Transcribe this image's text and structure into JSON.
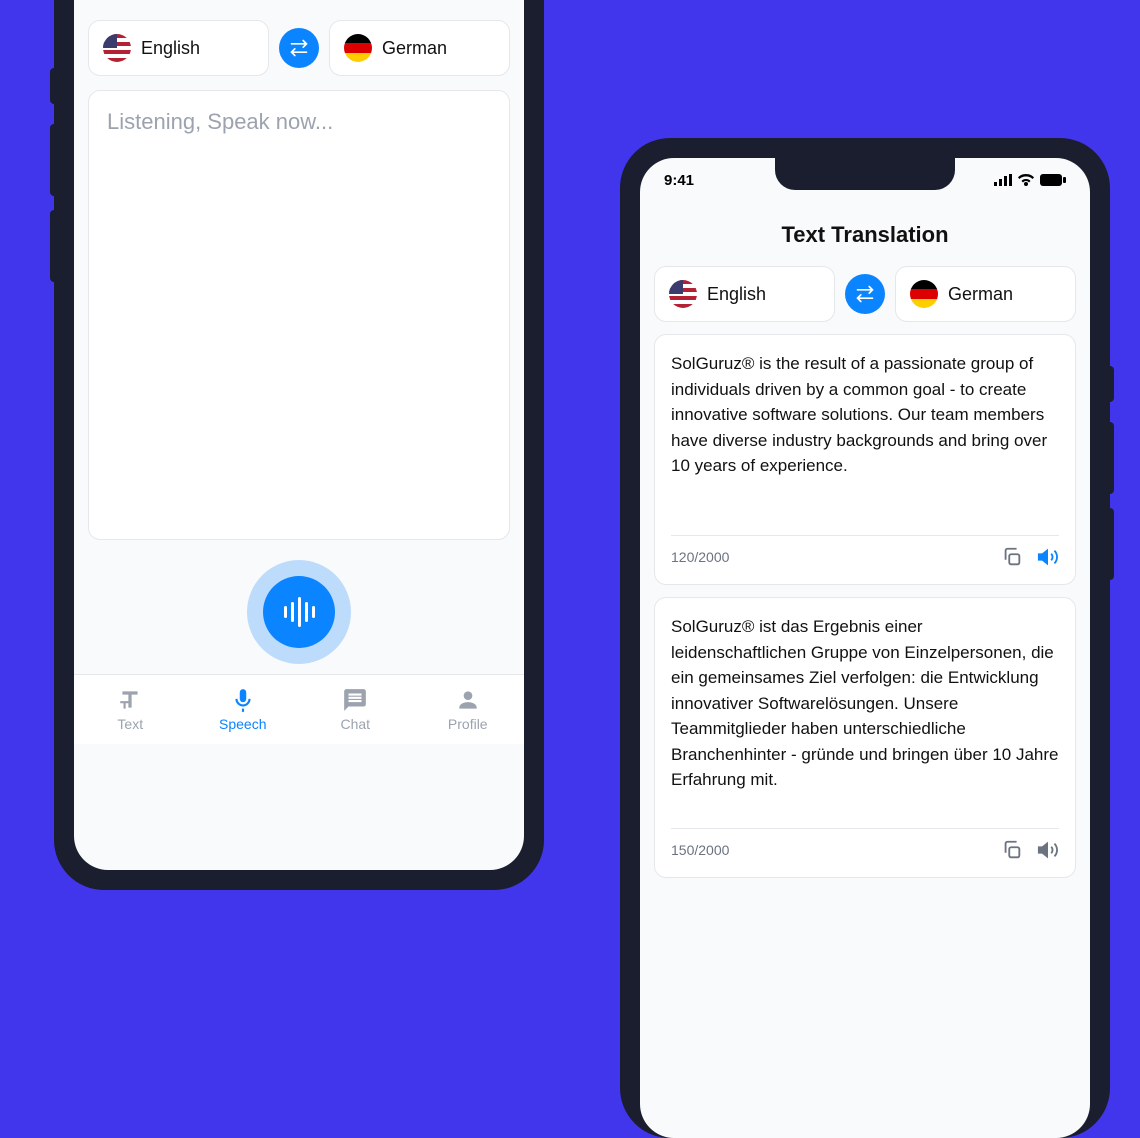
{
  "left": {
    "source_lang": "English",
    "target_lang": "German",
    "placeholder": "Listening, Speak now...",
    "tabs": {
      "text": "Text",
      "speech": "Speech",
      "chat": "Chat",
      "profile": "Profile"
    }
  },
  "right": {
    "statusbar_time": "9:41",
    "title": "Text Translation",
    "source_lang": "English",
    "target_lang": "German",
    "source_text": "SolGuruz® is the result of a passionate group of individuals driven by a common goal - to create innovative software solutions. Our team members have diverse industry backgrounds and bring over 10 years of experience.",
    "source_count": "120",
    "source_max": "2000",
    "target_text": "SolGuruz® ist das Ergebnis einer leidenschaftlichen Gruppe von Einzelpersonen, die ein gemeinsames Ziel verfolgen: die Entwicklung innovativer Softwarelösungen. Unsere Teammitglieder haben unterschiedliche Branchenhinter - gründe und bringen über 10 Jahre Erfahrung mit.",
    "target_count": "150",
    "target_max": "2000"
  }
}
